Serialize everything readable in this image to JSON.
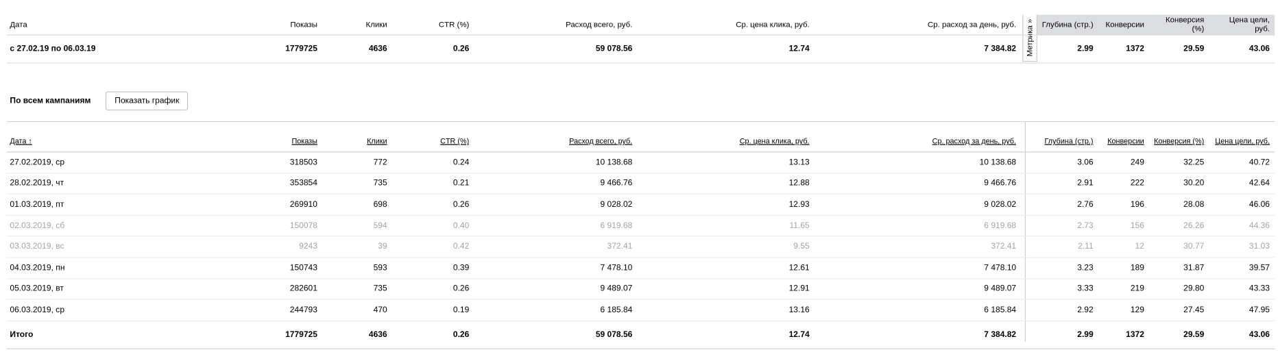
{
  "summary": {
    "columns": [
      "Дата",
      "Показы",
      "Клики",
      "CTR (%)",
      "Расход всего, руб.",
      "Ср. цена клика, руб.",
      "Ср. расход за день, руб.",
      "Глубина (стр.)",
      "Конверсии",
      "Конверсия (%)",
      "Цена цели, руб."
    ],
    "metrika_tab": "Метрика »",
    "row": [
      "с 27.02.19 по 06.03.19",
      "1779725",
      "4636",
      "0.26",
      "59 078.56",
      "12.74",
      "7 384.82",
      "2.99",
      "1372",
      "29.59",
      "43.06"
    ]
  },
  "campaigns": {
    "label": "По всем кампаниям",
    "show_chart_button": "Показать график"
  },
  "detail": {
    "columns": [
      "Дата ↑",
      "Показы",
      "Клики",
      "CTR (%)",
      "Расход всего, руб.",
      "Ср. цена клика, руб.",
      "Ср. расход за день, руб.",
      "Глубина (стр.)",
      "Конверсии",
      "Конверсия (%)",
      "Цена цели, руб."
    ],
    "rows": [
      [
        "27.02.2019, ср",
        "318503",
        "772",
        "0.24",
        "10 138.68",
        "13.13",
        "10 138.68",
        "3.06",
        "249",
        "32.25",
        "40.72"
      ],
      [
        "28.02.2019, чт",
        "353854",
        "735",
        "0.21",
        "9 466.76",
        "12.88",
        "9 466.76",
        "2.91",
        "222",
        "30.20",
        "42.64"
      ],
      [
        "01.03.2019, пт",
        "269910",
        "698",
        "0.26",
        "9 028.02",
        "12.93",
        "9 028.02",
        "2.76",
        "196",
        "28.08",
        "46.06"
      ],
      [
        "02.03.2019, сб",
        "150078",
        "594",
        "0.40",
        "6 919.68",
        "11.65",
        "6 919.68",
        "2.73",
        "156",
        "26.26",
        "44.36"
      ],
      [
        "03.03.2019, вс",
        "9243",
        "39",
        "0.42",
        "372.41",
        "9.55",
        "372.41",
        "2.11",
        "12",
        "30.77",
        "31.03"
      ],
      [
        "04.03.2019, пн",
        "150743",
        "593",
        "0.39",
        "7 478.10",
        "12.61",
        "7 478.10",
        "3.23",
        "189",
        "31.87",
        "39.57"
      ],
      [
        "05.03.2019, вт",
        "282601",
        "735",
        "0.26",
        "9 489.07",
        "12.91",
        "9 489.07",
        "3.33",
        "219",
        "29.80",
        "43.33"
      ],
      [
        "06.03.2019, ср",
        "244793",
        "470",
        "0.19",
        "6 185.84",
        "13.16",
        "6 185.84",
        "2.92",
        "129",
        "27.45",
        "47.95"
      ]
    ],
    "total": [
      "Итого",
      "1779725",
      "4636",
      "0.26",
      "59 078.56",
      "12.74",
      "7 384.82",
      "2.99",
      "1372",
      "29.59",
      "43.06"
    ]
  }
}
